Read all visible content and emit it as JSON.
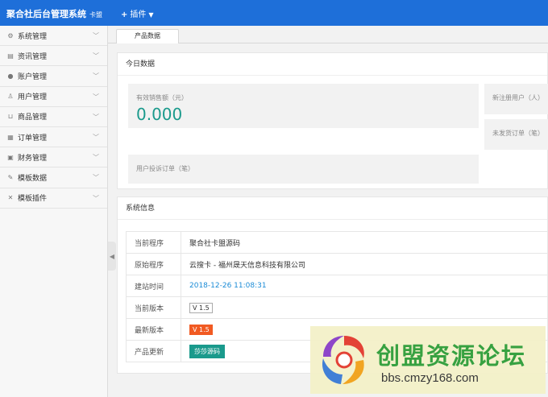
{
  "header": {
    "brand": "聚合社后台管理系统",
    "brand_sub": "卡盟",
    "plugin_menu": "插件"
  },
  "sidebar": {
    "items": [
      {
        "label": "系统管理",
        "icon": "gear-icon"
      },
      {
        "label": "资讯管理",
        "icon": "news-icon"
      },
      {
        "label": "账户管理",
        "icon": "user-icon"
      },
      {
        "label": "用户管理",
        "icon": "person-icon"
      },
      {
        "label": "商品管理",
        "icon": "cart-icon"
      },
      {
        "label": "订单管理",
        "icon": "clipboard-icon"
      },
      {
        "label": "财务管理",
        "icon": "wallet-icon"
      },
      {
        "label": "模板数据",
        "icon": "edit-icon"
      },
      {
        "label": "模板插件",
        "icon": "tools-icon"
      }
    ]
  },
  "tabs": {
    "active": "产品数据"
  },
  "today": {
    "title": "今日数据",
    "sales_label": "有效销售额（元）",
    "sales_value": "0.000",
    "new_users_label": "新注册用户（人）",
    "unshipped_label": "未发货订单（笔）",
    "complaints_label": "用户投诉订单（笔）"
  },
  "system": {
    "title": "系统信息",
    "rows": [
      {
        "key": "当前程序",
        "value": "聚合社卡盟源码"
      },
      {
        "key": "原始程序",
        "value": "云搜卡 - 福州晟天信息科技有限公司"
      },
      {
        "key": "建站时间",
        "value": "2018-12-26 11:08:31"
      },
      {
        "key": "当前版本",
        "value": "V 1.5"
      },
      {
        "key": "最新版本",
        "value": "V 1.5"
      },
      {
        "key": "产品更新",
        "value": "莎莎源码"
      }
    ]
  },
  "watermark": {
    "title": "创盟资源论坛",
    "url": "bbs.cmzy168.com"
  },
  "colors": {
    "topbar": "#1e6fd9",
    "accent": "#1a9a8c",
    "new_version": "#f15a22",
    "link": "#1a8bd6"
  }
}
